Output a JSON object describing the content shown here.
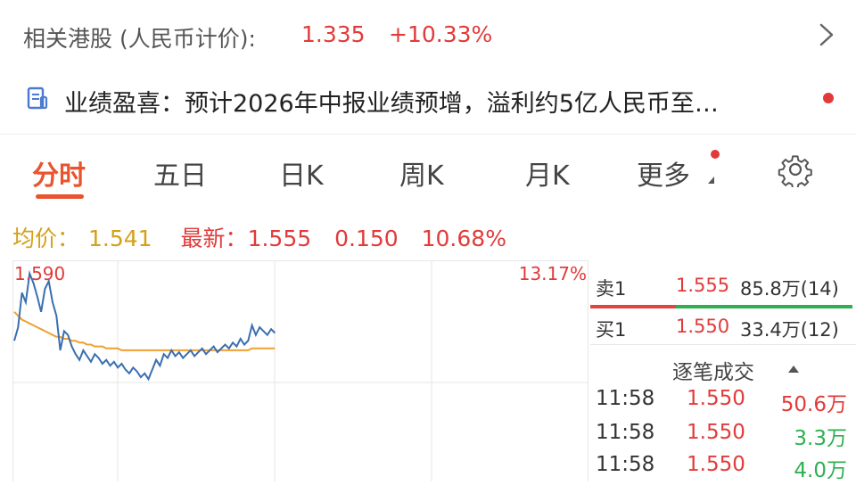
{
  "hk_row": {
    "label": "相关港股 (人民币计价):",
    "price": "1.335",
    "change_pct": "+10.33%"
  },
  "news": {
    "text": "业绩盈喜：预计2026年中报业绩预增，溢利约5亿人民币至…"
  },
  "tabs": [
    {
      "label": "分时",
      "active": true
    },
    {
      "label": "五日",
      "active": false
    },
    {
      "label": "日K",
      "active": false
    },
    {
      "label": "周K",
      "active": false
    },
    {
      "label": "月K",
      "active": false
    },
    {
      "label": "更多",
      "active": false
    }
  ],
  "stats": {
    "avg_label": "均价：",
    "avg_value": "1.541",
    "latest_label": "最新：",
    "latest_value": "1.555",
    "change": "0.150",
    "change_pct": "10.68%"
  },
  "colors": {
    "up": "#e23a3a",
    "down": "#2faf52",
    "accent": "#e8542e",
    "avg_line": "#f0a030",
    "price_line": "#3a6fb0"
  },
  "chart_data": {
    "type": "line",
    "y_top_label": "1.590",
    "right_top_label": "13.17%",
    "ylim": [
      1.53,
      1.595
    ],
    "x_sessions": 4,
    "series": [
      {
        "values": [
          1.555,
          1.562,
          1.58,
          1.575,
          1.59,
          1.585,
          1.578,
          1.57,
          1.582,
          1.586,
          1.575,
          1.568,
          1.55,
          1.56,
          1.558,
          1.552,
          1.548,
          1.545,
          1.55,
          1.547,
          1.544,
          1.548,
          1.546,
          1.543,
          1.545,
          1.542,
          1.544,
          1.541,
          1.543,
          1.54,
          1.538,
          1.541,
          1.539,
          1.536,
          1.538,
          1.535,
          1.54,
          1.545,
          1.542,
          1.548,
          1.546,
          1.55,
          1.547,
          1.549,
          1.546,
          1.548,
          1.55,
          1.547,
          1.549,
          1.551,
          1.548,
          1.55,
          1.552,
          1.549,
          1.551,
          1.553,
          1.551,
          1.554,
          1.552,
          1.556,
          1.553,
          1.555,
          1.563,
          1.558,
          1.562,
          1.56,
          1.558,
          1.561,
          1.559
        ]
      },
      {
        "values": [
          1.57,
          1.568,
          1.566,
          1.565,
          1.564,
          1.563,
          1.562,
          1.561,
          1.56,
          1.559,
          1.558,
          1.557,
          1.557,
          1.556,
          1.556,
          1.555,
          1.555,
          1.554,
          1.554,
          1.553,
          1.553,
          1.552,
          1.552,
          1.552,
          1.551,
          1.551,
          1.551,
          1.551,
          1.55,
          1.55,
          1.55,
          1.55,
          1.55,
          1.55,
          1.55,
          1.55,
          1.55,
          1.55,
          1.55,
          1.55,
          1.55,
          1.55,
          1.55,
          1.55,
          1.55,
          1.55,
          1.55,
          1.55,
          1.55,
          1.55,
          1.55,
          1.55,
          1.55,
          1.55,
          1.55,
          1.55,
          1.55,
          1.55,
          1.55,
          1.55,
          1.55,
          1.55,
          1.551,
          1.551,
          1.551,
          1.551,
          1.551,
          1.551,
          1.551
        ]
      }
    ]
  },
  "orderbook": {
    "ask": {
      "label": "卖1",
      "price": "1.555",
      "volume": "85.8万(14)"
    },
    "bid": {
      "label": "买1",
      "price": "1.550",
      "volume": "33.4万(12)"
    }
  },
  "trades": {
    "title": "逐笔成交",
    "rows": [
      {
        "time": "11:58",
        "price": "1.550",
        "volume": "50.6万",
        "side": "up"
      },
      {
        "time": "11:58",
        "price": "1.550",
        "volume": "3.3万",
        "side": "down"
      },
      {
        "time": "11:58",
        "price": "1.550",
        "volume": "4.0万",
        "side": "down"
      }
    ]
  },
  "icons": [
    "chevron-right-icon",
    "report-icon",
    "gear-icon"
  ]
}
